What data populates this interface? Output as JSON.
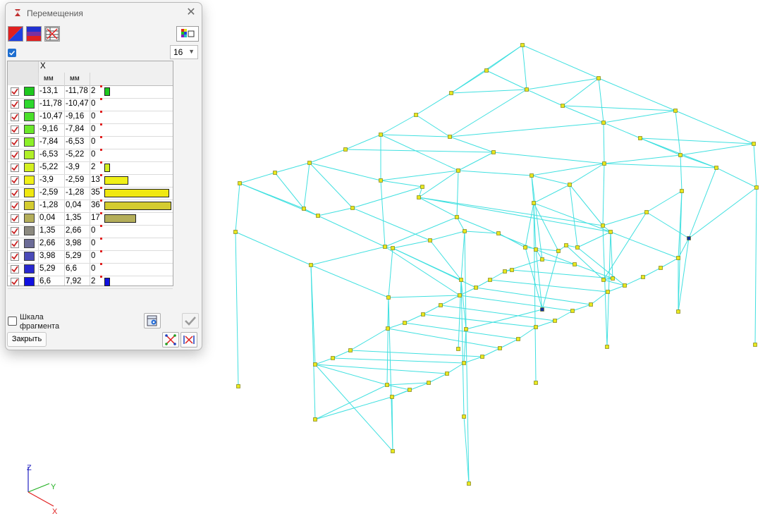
{
  "window": {
    "title": "Перемещения",
    "close_icon": "close-icon"
  },
  "toolbar": {
    "icons": [
      "color-mode-icon",
      "gradient-icon",
      "table-mode-icon",
      "palette-settings-icon"
    ]
  },
  "scale": {
    "checked": true,
    "count": "16"
  },
  "table": {
    "direction_header": "X",
    "unit_from": "мм",
    "unit_to": "мм",
    "rows": [
      {
        "from": "-13,1",
        "to": "-11,78",
        "count": "2",
        "color": "#1ec81e"
      },
      {
        "from": "-11,78",
        "to": "-10,47",
        "count": "0",
        "color": "#2ed82e"
      },
      {
        "from": "-10,47",
        "to": "-9,16",
        "count": "0",
        "color": "#4ae02a"
      },
      {
        "from": "-9,16",
        "to": "-7,84",
        "count": "0",
        "color": "#6ae82a"
      },
      {
        "from": "-7,84",
        "to": "-6,53",
        "count": "0",
        "color": "#8cf028"
      },
      {
        "from": "-6,53",
        "to": "-5,22",
        "count": "0",
        "color": "#b0f028"
      },
      {
        "from": "-5,22",
        "to": "-3,9",
        "count": "2",
        "color": "#d4f020"
      },
      {
        "from": "-3,9",
        "to": "-2,59",
        "count": "13",
        "color": "#f0f018"
      },
      {
        "from": "-2,59",
        "to": "-1,28",
        "count": "35",
        "color": "#f0e810"
      },
      {
        "from": "-1,28",
        "to": "0,04",
        "count": "36",
        "color": "#d4cc30"
      },
      {
        "from": "0,04",
        "to": "1,35",
        "count": "17",
        "color": "#b4ae5a"
      },
      {
        "from": "1,35",
        "to": "2,66",
        "count": "0",
        "color": "#8c8a80"
      },
      {
        "from": "2,66",
        "to": "3,98",
        "count": "0",
        "color": "#6c6c98"
      },
      {
        "from": "3,98",
        "to": "5,29",
        "count": "0",
        "color": "#4a4ab8"
      },
      {
        "from": "5,29",
        "to": "6,6",
        "count": "0",
        "color": "#2828d0"
      },
      {
        "from": "6,6",
        "to": "7,92",
        "count": "2",
        "color": "#1010e0"
      }
    ]
  },
  "fragment_scale": {
    "label_line1": "Шкала",
    "label_line2": "фрагмента",
    "checked": false
  },
  "buttons": {
    "close_label": "Закрыть"
  },
  "axes": {
    "z": "Z",
    "y": "Y",
    "x": "X"
  },
  "colors": {
    "member": "#40e0e0",
    "node": "#e8e820",
    "axis_z": "#2020c0",
    "axis_y": "#20b020",
    "axis_x": "#e02020"
  }
}
